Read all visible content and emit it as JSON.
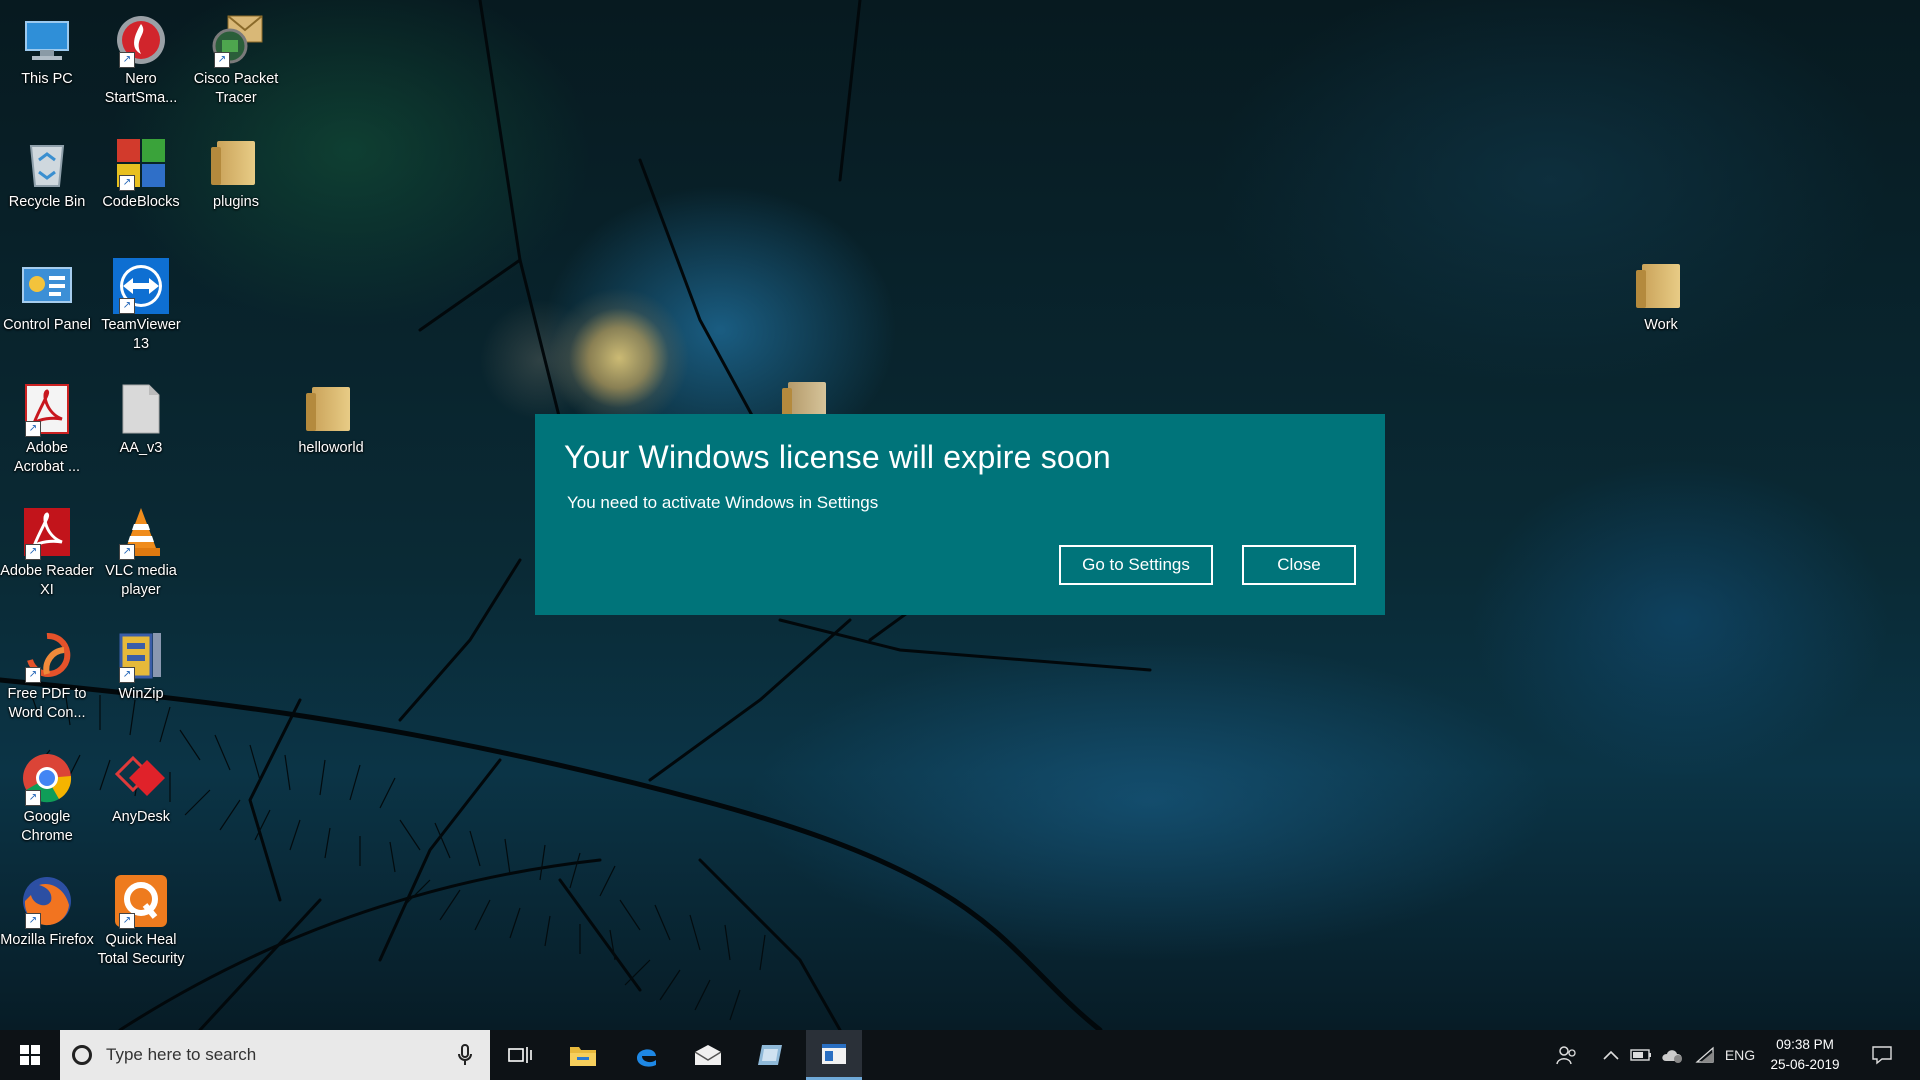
{
  "desktop": {
    "icons": [
      {
        "label": "This PC",
        "icon": "computer-icon"
      },
      {
        "label": "Nero StartSma...",
        "icon": "nero-icon"
      },
      {
        "label": "Cisco Packet Tracer",
        "icon": "cisco-packet-tracer-icon"
      },
      {
        "label": "Recycle Bin",
        "icon": "recycle-bin-icon"
      },
      {
        "label": "CodeBlocks",
        "icon": "codeblocks-icon"
      },
      {
        "label": "plugins",
        "icon": "folder-icon"
      },
      {
        "label": "Control Panel",
        "icon": "control-panel-icon"
      },
      {
        "label": "TeamViewer 13",
        "icon": "teamviewer-icon"
      },
      {
        "label": "Adobe Acrobat ...",
        "icon": "adobe-acrobat-icon"
      },
      {
        "label": "AA_v3",
        "icon": "file-icon"
      },
      {
        "label": "helloworld",
        "icon": "folder-icon"
      },
      {
        "label": "Adobe Reader XI",
        "icon": "adobe-reader-icon"
      },
      {
        "label": "VLC media player",
        "icon": "vlc-icon"
      },
      {
        "label": "Free PDF to Word Con...",
        "icon": "pdf-to-word-icon"
      },
      {
        "label": "WinZip",
        "icon": "winzip-icon"
      },
      {
        "label": "Google Chrome",
        "icon": "chrome-icon"
      },
      {
        "label": "AnyDesk",
        "icon": "anydesk-icon"
      },
      {
        "label": "Mozilla Firefox",
        "icon": "firefox-icon"
      },
      {
        "label": "Quick Heal Total Security",
        "icon": "quick-heal-icon"
      },
      {
        "label": "Work",
        "icon": "folder-icon"
      }
    ]
  },
  "dialog": {
    "title": "Your Windows license will expire soon",
    "message": "You need to activate Windows in Settings",
    "settings_button": "Go to Settings",
    "close_button": "Close",
    "background_color": "#00747a"
  },
  "taskbar": {
    "search_placeholder": "Type here to search",
    "apps": [
      "task-view-icon",
      "file-explorer-icon",
      "edge-icon",
      "mail-icon",
      "app-icon",
      "active-window-icon"
    ],
    "tray": {
      "language": "ENG",
      "time": "09:38 PM",
      "date": "25-06-2019"
    }
  }
}
